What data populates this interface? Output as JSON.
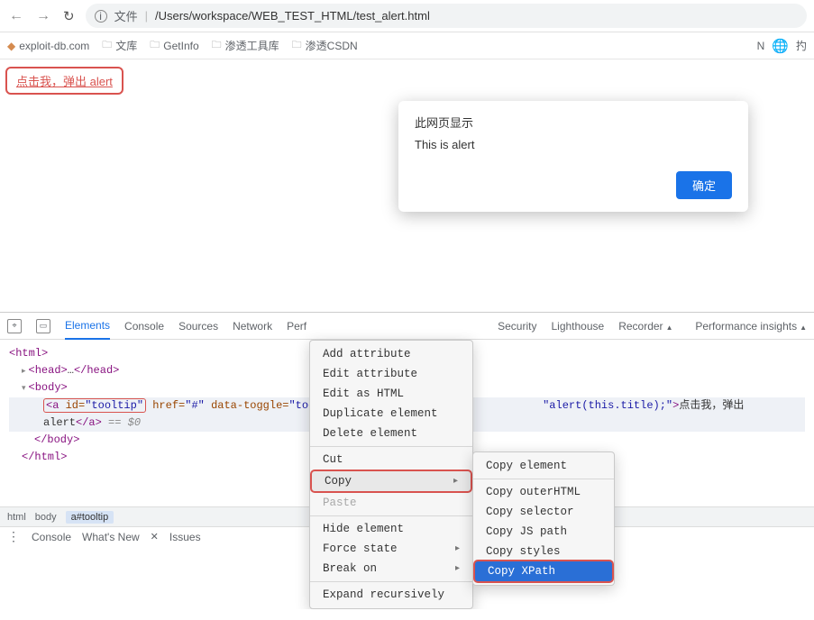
{
  "toolbar": {
    "file_prefix": "文件",
    "path": "/Users/workspace/WEB_TEST_HTML/test_alert.html"
  },
  "bookmarks": {
    "items": [
      {
        "label": "exploit-db.com",
        "type": "site"
      },
      {
        "label": "文库",
        "type": "folder"
      },
      {
        "label": "GetInfo",
        "type": "folder"
      },
      {
        "label": "渗透工具库",
        "type": "folder"
      },
      {
        "label": "渗透CSDN",
        "type": "folder"
      }
    ],
    "right_partial_chars": [
      "N",
      "扚"
    ]
  },
  "page": {
    "link_text": "点击我，弹出 alert"
  },
  "alert": {
    "title": "此网页显示",
    "message": "This is alert",
    "ok_label": "确定"
  },
  "devtools": {
    "tabs": [
      "Elements",
      "Console",
      "Sources",
      "Network",
      "Perf",
      "Security",
      "Lighthouse",
      "Recorder"
    ],
    "right_tab": "Performance insights",
    "dom": {
      "line0": "<html>",
      "line1_a": "<head>",
      "line1_b": "…",
      "line1_c": "</head>",
      "line2": "<body>",
      "line3": {
        "tag_open": "<a ",
        "attr1_name": "id=",
        "attr1_val": "\"tooltip\"",
        "attr2": "href=\"#\"",
        "attr3": "data-toggle=\"tooltip\"",
        "attr_trunc": "t",
        "attr5": "\"alert(this.title);\"",
        "text": "点击我，弹出 alert",
        "close": "</a>",
        "tail": " == $0"
      },
      "line4": "</body>",
      "line5": "</html>"
    },
    "ctx_menu": [
      {
        "label": "Add attribute"
      },
      {
        "label": "Edit attribute"
      },
      {
        "label": "Edit as HTML"
      },
      {
        "label": "Duplicate element"
      },
      {
        "label": "Delete element"
      },
      {
        "sep": true
      },
      {
        "label": "Cut"
      },
      {
        "label": "Copy",
        "has_sub": true,
        "highlighted": true
      },
      {
        "label": "Paste",
        "disabled": true
      },
      {
        "sep": true
      },
      {
        "label": "Hide element"
      },
      {
        "label": "Force state",
        "has_sub": true
      },
      {
        "label": "Break on",
        "has_sub": true
      },
      {
        "sep": true
      },
      {
        "label": "Expand recursively"
      }
    ],
    "ctx_submenu": [
      {
        "label": "Copy element"
      },
      {
        "sep": true
      },
      {
        "label": "Copy outerHTML"
      },
      {
        "label": "Copy selector"
      },
      {
        "label": "Copy JS path"
      },
      {
        "label": "Copy styles"
      },
      {
        "label": "Copy XPath",
        "active": true
      }
    ],
    "breadcrumb": [
      "html",
      "body",
      "a#tooltip"
    ],
    "footer": [
      "Console",
      "What's New",
      "Issues"
    ]
  }
}
